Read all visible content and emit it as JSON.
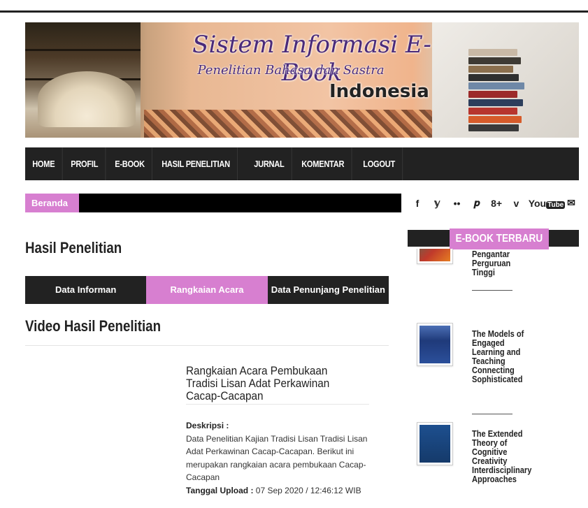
{
  "banner": {
    "title_line1": "Sistem Informasi E-Book",
    "title_line2": "Penelitian Bahasa dan Sastra",
    "title_line3": "Indonesia"
  },
  "nav": {
    "items": [
      "HOME",
      "PROFIL",
      "E-BOOK",
      "HASIL PENELITIAN",
      "JURNAL",
      "KOMENTAR",
      "LOGOUT"
    ]
  },
  "breadcrumb": {
    "home": "Beranda"
  },
  "social": {
    "icons": [
      "facebook-icon",
      "twitter-icon",
      "flickr-icon",
      "pinterest-icon",
      "google-plus-icon",
      "vimeo-icon",
      "youtube-icon",
      "email-icon"
    ],
    "glyphs": [
      "f",
      "𝕪",
      "••",
      "𝒑",
      "8+",
      "v",
      "You",
      "✉"
    ],
    "youtube_box": "Tube"
  },
  "main": {
    "page_title": "Hasil Penelitian",
    "tabs": [
      "Data Informan",
      "Rangkaian Acara",
      "Data Penunjang Penelitian"
    ],
    "active_tab": 1,
    "section_title": "Video Hasil Penelitian",
    "video": {
      "title": "Rangkaian Acara Pembukaan Tradisi Lisan Adat Perkawinan Cacap-Cacapan",
      "desc_label": "Deskripsi :",
      "desc_text": "Data Penelitian Kajian Tradisi Lisan Tradisi Lisan Adat Perkawinan Cacap-Cacapan. Berikut ini merupakan rangkaian acara pembukaan Cacap-Cacapan",
      "upload_label": "Tanggal Upload :",
      "upload_value": "07 Sep 2020 / 12:46:12 WIB"
    }
  },
  "sidebar": {
    "heading": "E-BOOK TERBARU",
    "books": [
      {
        "title": "mata Kuliah Pengantar Perguruan Tinggi",
        "color": "#2e7d62"
      },
      {
        "title": "The Models of Engaged Learning and Teaching Connecting Sophisticated",
        "color": "#1f3a7a"
      },
      {
        "title": "The Extended Theory of Cognitive Creativity Interdisciplinary Approaches",
        "color": "#1d4f8f"
      }
    ]
  }
}
